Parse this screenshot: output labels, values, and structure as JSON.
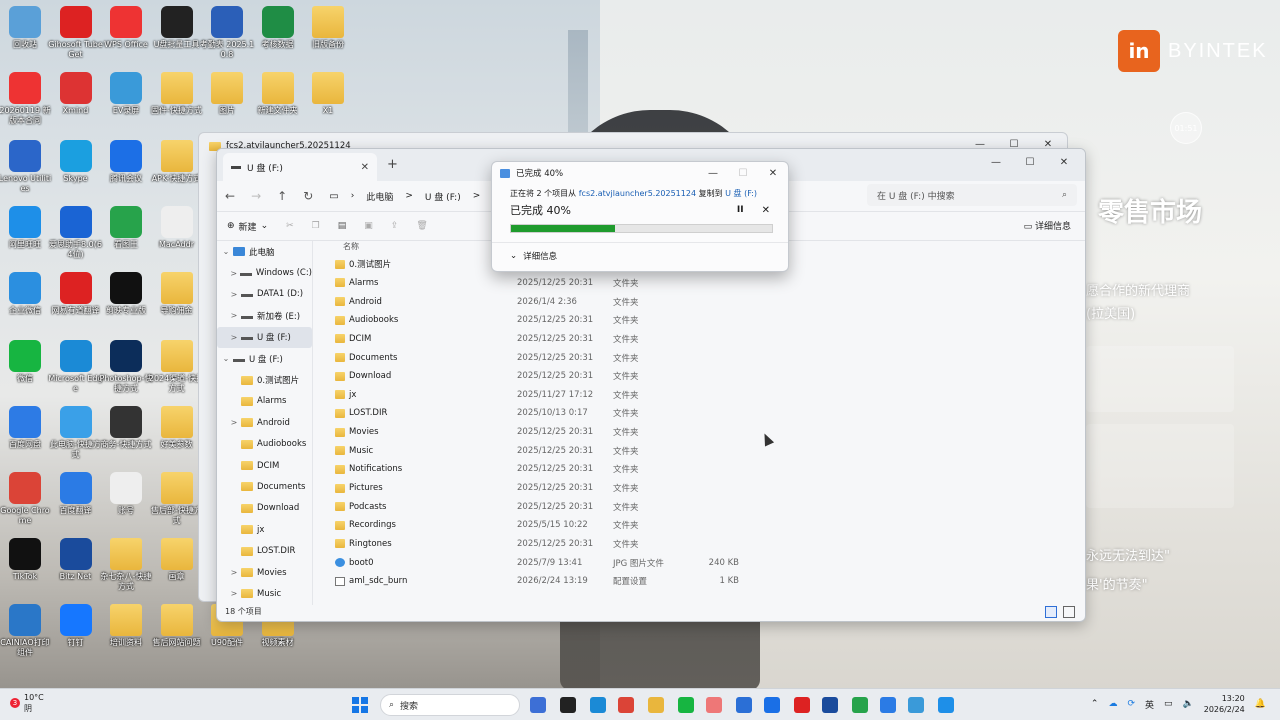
{
  "desktop": {
    "icons": [
      {
        "label": "回收站",
        "color": "#5aa0d8"
      },
      {
        "label": "Gihosoft TubeGet",
        "color": "#d22"
      },
      {
        "label": "WPS Office",
        "color": "#e33"
      },
      {
        "label": "U盘批量工具",
        "color": "#222"
      },
      {
        "label": "考勤表 2025.10.8",
        "color": "#2b5fb8"
      },
      {
        "label": "考核数据",
        "color": "#1f8d45"
      },
      {
        "label": "旧版备份",
        "color": "folder"
      },
      {
        "label": "20260119 新版本合同",
        "color": "#e33"
      },
      {
        "label": "Xmind",
        "color": "#d33"
      },
      {
        "label": "EV录屏",
        "color": "#3a9ad9"
      },
      {
        "label": "固件-快捷方式",
        "color": "folder"
      },
      {
        "label": "图片",
        "color": "folder"
      },
      {
        "label": "新建文件夹",
        "color": "folder"
      },
      {
        "label": "X1",
        "color": "folder"
      },
      {
        "label": "Lenovo Utilities",
        "color": "#2b66c9"
      },
      {
        "label": "Skype",
        "color": "#1b9fe0"
      },
      {
        "label": "腾讯会议",
        "color": "#1c6fe6"
      },
      {
        "label": "APK-快捷方式",
        "color": "folder"
      },
      {
        "label": "阿里旺旺",
        "color": "#1e8fe8"
      },
      {
        "label": "爱思助手8.0(64位)",
        "color": "#1a64d4"
      },
      {
        "label": "看图王",
        "color": "#27a34b"
      },
      {
        "label": "MacAddr",
        "color": "#eee"
      },
      {
        "label": "企业微信",
        "color": "#2b8fe0"
      },
      {
        "label": "网易有道翻译",
        "color": "#d22"
      },
      {
        "label": "剪映专业版",
        "color": "#111"
      },
      {
        "label": "导购佣金",
        "color": "folder"
      },
      {
        "label": "微信",
        "color": "#17b541"
      },
      {
        "label": "Microsoft Edge",
        "color": "#1b8ad6"
      },
      {
        "label": "Photoshop-快捷方式",
        "color": "#0c2d5a"
      },
      {
        "label": "2024渠道-快捷方式",
        "color": "folder"
      },
      {
        "label": "百度网盘",
        "color": "#2d7be5"
      },
      {
        "label": "此电脑-快捷方式",
        "color": "#3aa0e8"
      },
      {
        "label": "商务-快捷方式",
        "color": "#333"
      },
      {
        "label": "好美参数",
        "color": "folder"
      },
      {
        "label": "Google Chrome",
        "color": "#db4437"
      },
      {
        "label": "百度翻译",
        "color": "#2b7be5"
      },
      {
        "label": "账号",
        "color": "#eee"
      },
      {
        "label": "售后部-快捷方式",
        "color": "folder"
      },
      {
        "label": "TikTok",
        "color": "#111"
      },
      {
        "label": "Bitz Net",
        "color": "#1a4b9c"
      },
      {
        "label": "杂七杂八-快捷方式",
        "color": "folder"
      },
      {
        "label": "画章",
        "color": "folder"
      },
      {
        "label": "CAINIAO打印组件",
        "color": "#2a77c8"
      },
      {
        "label": "钉钉",
        "color": "#1677ff"
      },
      {
        "label": "培训资料",
        "color": "folder"
      },
      {
        "label": "售后网站问题",
        "color": "folder"
      },
      {
        "label": "U90配件",
        "color": "folder"
      },
      {
        "label": "视频素材",
        "color": "folder"
      }
    ]
  },
  "wallpaper": {
    "brand": "BYINTEK",
    "brand_mark": "in",
    "bubble_time": "01:51",
    "lines": [
      "零售市场",
      "愿合作的新代理商",
      "(拉美国)",
      "永远无法到达\"",
      "果'的节奏\""
    ]
  },
  "back_window": {
    "title": "fcs2.atvjlauncher5.20251124"
  },
  "explorer": {
    "tab_title": "U 盘 (F:)",
    "new_tab": "+",
    "controls": [
      "—",
      "☐",
      "✕"
    ],
    "breadcrumb": [
      "此电脑",
      ">",
      "U 盘 (F:)",
      ">"
    ],
    "search_placeholder": "在 U 盘 (F:) 中搜索",
    "toolbar_new": "新建",
    "details_label": "详细信息",
    "column_name": "名称",
    "nav": [
      {
        "label": "此电脑",
        "type": "pc",
        "chev": "⌄",
        "indent": 0
      },
      {
        "label": "Windows (C:)",
        "type": "drive",
        "chev": ">",
        "indent": 1
      },
      {
        "label": "DATA1 (D:)",
        "type": "drive",
        "chev": ">",
        "indent": 1
      },
      {
        "label": "新加卷 (E:)",
        "type": "drive",
        "chev": ">",
        "indent": 1
      },
      {
        "label": "U 盘 (F:)",
        "type": "drive",
        "chev": ">",
        "indent": 1,
        "selected": true
      },
      {
        "label": "U 盘 (F:)",
        "type": "drive",
        "chev": "⌄",
        "indent": 0
      },
      {
        "label": "0.测试图片",
        "type": "folder",
        "chev": "",
        "indent": 1
      },
      {
        "label": "Alarms",
        "type": "folder",
        "chev": "",
        "indent": 1
      },
      {
        "label": "Android",
        "type": "folder",
        "chev": ">",
        "indent": 1
      },
      {
        "label": "Audiobooks",
        "type": "folder",
        "chev": "",
        "indent": 1
      },
      {
        "label": "DCIM",
        "type": "folder",
        "chev": "",
        "indent": 1
      },
      {
        "label": "Documents",
        "type": "folder",
        "chev": "",
        "indent": 1
      },
      {
        "label": "Download",
        "type": "folder",
        "chev": "",
        "indent": 1
      },
      {
        "label": "jx",
        "type": "folder",
        "chev": "",
        "indent": 1
      },
      {
        "label": "LOST.DIR",
        "type": "folder",
        "chev": "",
        "indent": 1
      },
      {
        "label": "Movies",
        "type": "folder",
        "chev": ">",
        "indent": 1
      },
      {
        "label": "Music",
        "type": "folder",
        "chev": ">",
        "indent": 1
      }
    ],
    "files": [
      {
        "name": "0.测试图片",
        "date": "",
        "type": "",
        "size": "",
        "kind": "folder"
      },
      {
        "name": "Alarms",
        "date": "2025/12/25 20:31",
        "type": "文件夹",
        "size": "",
        "kind": "folder"
      },
      {
        "name": "Android",
        "date": "2026/1/4 2:36",
        "type": "文件夹",
        "size": "",
        "kind": "folder"
      },
      {
        "name": "Audiobooks",
        "date": "2025/12/25 20:31",
        "type": "文件夹",
        "size": "",
        "kind": "folder"
      },
      {
        "name": "DCIM",
        "date": "2025/12/25 20:31",
        "type": "文件夹",
        "size": "",
        "kind": "folder"
      },
      {
        "name": "Documents",
        "date": "2025/12/25 20:31",
        "type": "文件夹",
        "size": "",
        "kind": "folder"
      },
      {
        "name": "Download",
        "date": "2025/12/25 20:31",
        "type": "文件夹",
        "size": "",
        "kind": "folder"
      },
      {
        "name": "jx",
        "date": "2025/11/27 17:12",
        "type": "文件夹",
        "size": "",
        "kind": "folder"
      },
      {
        "name": "LOST.DIR",
        "date": "2025/10/13 0:17",
        "type": "文件夹",
        "size": "",
        "kind": "folder"
      },
      {
        "name": "Movies",
        "date": "2025/12/25 20:31",
        "type": "文件夹",
        "size": "",
        "kind": "folder"
      },
      {
        "name": "Music",
        "date": "2025/12/25 20:31",
        "type": "文件夹",
        "size": "",
        "kind": "folder"
      },
      {
        "name": "Notifications",
        "date": "2025/12/25 20:31",
        "type": "文件夹",
        "size": "",
        "kind": "folder"
      },
      {
        "name": "Pictures",
        "date": "2025/12/25 20:31",
        "type": "文件夹",
        "size": "",
        "kind": "folder"
      },
      {
        "name": "Podcasts",
        "date": "2025/12/25 20:31",
        "type": "文件夹",
        "size": "",
        "kind": "folder"
      },
      {
        "name": "Recordings",
        "date": "2025/5/15 10:22",
        "type": "文件夹",
        "size": "",
        "kind": "folder"
      },
      {
        "name": "Ringtones",
        "date": "2025/12/25 20:31",
        "type": "文件夹",
        "size": "",
        "kind": "folder"
      },
      {
        "name": "boot0",
        "date": "2025/7/9 13:41",
        "type": "JPG 图片文件",
        "size": "240 KB",
        "kind": "image"
      },
      {
        "name": "aml_sdc_burn",
        "date": "2026/2/24 13:19",
        "type": "配置设置",
        "size": "1 KB",
        "kind": "config"
      }
    ],
    "status": "18 个项目"
  },
  "copy_dialog": {
    "title": "已完成 40%",
    "line_prefix": "正在将 2 个项目从",
    "source": "fcs2.atvjlauncher5.20251124",
    "mid": "复制到",
    "dest": "U 盘 (F:)",
    "percent_label": "已完成 40%",
    "progress": 0.4,
    "pause": "II",
    "stop": "✕",
    "more": "详细信息",
    "controls": [
      "—",
      "☐",
      "✕"
    ]
  },
  "taskbar": {
    "weather_temp": "10°C",
    "weather_desc": "阴",
    "weather_badge": "3",
    "search_placeholder": "搜索",
    "lang": "英",
    "time": "13:20",
    "date": "2026/2/24",
    "apps": [
      "#3d6fd6",
      "#222",
      "#1b8ad6",
      "#db4437",
      "#e9b63d",
      "#17b541",
      "#e77",
      "#2b6fd6",
      "#1a6fe6",
      "#d22",
      "#1a4b9c",
      "#27a34b",
      "#2b7be5",
      "#3a9ad9",
      "#1e8fe8"
    ]
  }
}
